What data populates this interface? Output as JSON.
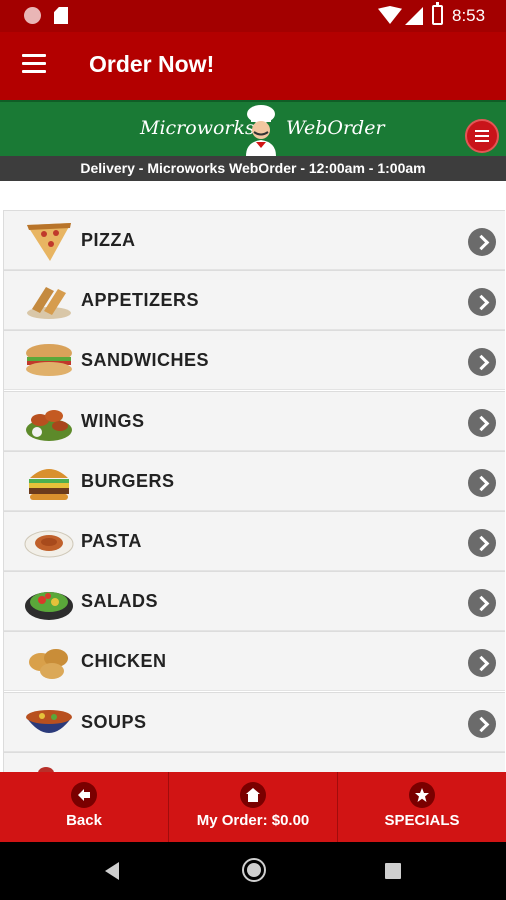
{
  "status_bar": {
    "time": "8:53"
  },
  "app_bar": {
    "title": "Order Now!"
  },
  "brand": {
    "left": "Microworks",
    "right": "WebOrder"
  },
  "info": "Delivery - Microworks WebOrder - 12:00am - 1:00am",
  "menu": [
    {
      "label": "PIZZA",
      "icon": "pizza-icon"
    },
    {
      "label": "APPETIZERS",
      "icon": "appetizers-icon"
    },
    {
      "label": "SANDWICHES",
      "icon": "sandwich-icon"
    },
    {
      "label": "WINGS",
      "icon": "wings-icon"
    },
    {
      "label": "BURGERS",
      "icon": "burger-icon"
    },
    {
      "label": "PASTA",
      "icon": "pasta-icon"
    },
    {
      "label": "SALADS",
      "icon": "salad-icon"
    },
    {
      "label": "CHICKEN",
      "icon": "chicken-icon"
    },
    {
      "label": "SOUPS",
      "icon": "soup-icon"
    }
  ],
  "bottom_nav": {
    "back": "Back",
    "order": "My Order: $0.00",
    "specials": "SPECIALS"
  },
  "colors": {
    "primary": "#b30000",
    "brand_green": "#1a7a35",
    "info_bar": "#3d3d3d",
    "tab_bar": "#d11414"
  }
}
